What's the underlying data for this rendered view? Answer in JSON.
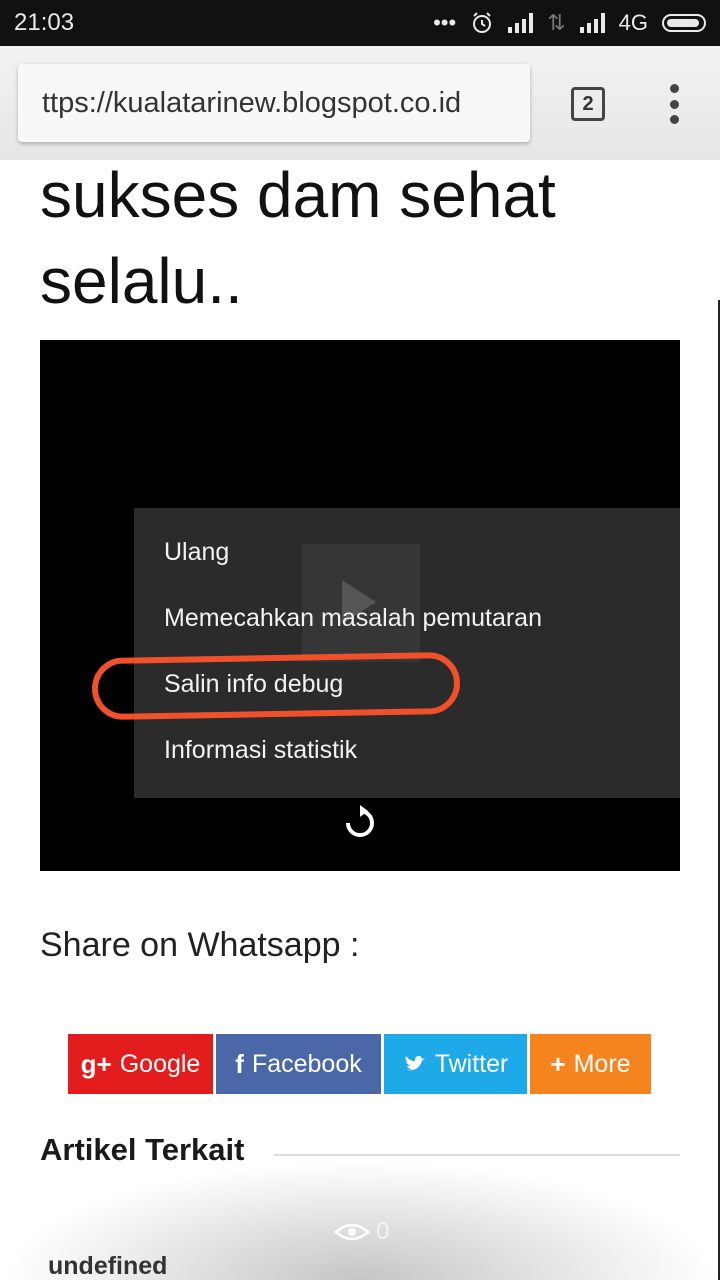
{
  "status_bar": {
    "time": "21:03",
    "network": "4G",
    "icons": [
      "more-dots-icon",
      "alarm-icon",
      "signal-icon",
      "data-arrows-icon",
      "signal-icon",
      "battery-icon"
    ]
  },
  "browser": {
    "url": "ttps://kualatarinew.blogspot.co.id",
    "tab_count": "2"
  },
  "article": {
    "heading": "sukses dam sehat selalu.."
  },
  "video_menu": {
    "items": [
      "Ulang",
      "Memecahkan masalah pemutaran",
      "Salin info debug",
      "Informasi statistik"
    ],
    "highlighted_item": "Salin info debug",
    "annotation_color": "#f0512a"
  },
  "share": {
    "label": "Share on Whatsapp :",
    "buttons": [
      {
        "icon": "g+",
        "label": "Google",
        "color": "#e31d1d"
      },
      {
        "icon": "f",
        "label": "Facebook",
        "color": "#4a68a8"
      },
      {
        "icon": "bird",
        "label": "Twitter",
        "color": "#1ea9e8"
      },
      {
        "icon": "+",
        "label": "More",
        "color": "#f5841f"
      }
    ]
  },
  "related": {
    "title": "Artikel Terkait"
  },
  "overlay": {
    "view_count": "0"
  },
  "footer": {
    "undefined_text": "undefined"
  }
}
